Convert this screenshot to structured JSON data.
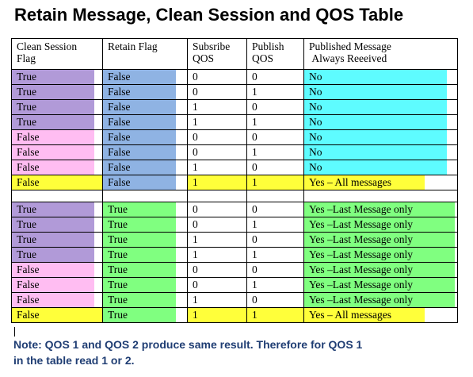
{
  "title": "Retain Message, Clean Session and QOS Table",
  "headers": {
    "clean_session": [
      "Clean Session",
      "Flag"
    ],
    "retain_flag": "Retain Flag",
    "subscribe_qos": [
      "Subsribe",
      "QOS"
    ],
    "publish_qos": [
      "Publish",
      "QOS"
    ],
    "published_message": [
      "Published Message",
      "Always Reeeived"
    ]
  },
  "rows": [
    {
      "clean": "True",
      "retain": "False",
      "sub": "0",
      "pub": "0",
      "received": "No"
    },
    {
      "clean": "True",
      "retain": "False",
      "sub": "0",
      "pub": "1",
      "received": "No"
    },
    {
      "clean": "True",
      "retain": "False",
      "sub": "1",
      "pub": "0",
      "received": "No"
    },
    {
      "clean": "True",
      "retain": "False",
      "sub": "1",
      "pub": "1",
      "received": "No"
    },
    {
      "clean": "False",
      "retain": "False",
      "sub": "0",
      "pub": "0",
      "received": "No"
    },
    {
      "clean": "False",
      "retain": "False",
      "sub": "0",
      "pub": "1",
      "received": "No"
    },
    {
      "clean": "False",
      "retain": "False",
      "sub": "1",
      "pub": "0",
      "received": "No"
    },
    {
      "clean": "False",
      "retain": "False",
      "sub": "1",
      "pub": "1",
      "received": "Yes – All messages"
    },
    {
      "clean": "True",
      "retain": "True",
      "sub": "0",
      "pub": "0",
      "received": "Yes –Last Message only"
    },
    {
      "clean": "True",
      "retain": "True",
      "sub": "0",
      "pub": "1",
      "received": "Yes –Last Message only"
    },
    {
      "clean": "True",
      "retain": "True",
      "sub": "1",
      "pub": "0",
      "received": "Yes –Last Message only"
    },
    {
      "clean": "True",
      "retain": "True",
      "sub": "1",
      "pub": "1",
      "received": "Yes –Last Message only"
    },
    {
      "clean": "False",
      "retain": "True",
      "sub": "0",
      "pub": "0",
      "received": "Yes –Last Message only"
    },
    {
      "clean": "False",
      "retain": "True",
      "sub": "0",
      "pub": "1",
      "received": "Yes –Last Message only"
    },
    {
      "clean": "False",
      "retain": "True",
      "sub": "1",
      "pub": "0",
      "received": "Yes –Last Message only"
    },
    {
      "clean": "False",
      "retain": "True",
      "sub": "1",
      "pub": "1",
      "received": "Yes – All messages"
    }
  ],
  "note": [
    "Note: QOS 1 and QOS 2 produce same result. Therefore for QOS 1",
    " in the table read 1 or 2."
  ],
  "colors": {
    "clean_true": "#b19ad8",
    "clean_false": "#ffbdf2",
    "retain_false": "#8fb3e3",
    "retain_true": "#80ff80",
    "received_no": "#5efcff",
    "received_last": "#80ff80",
    "highlight_all": "#ffff3a",
    "note_text": "#1f3d73"
  }
}
